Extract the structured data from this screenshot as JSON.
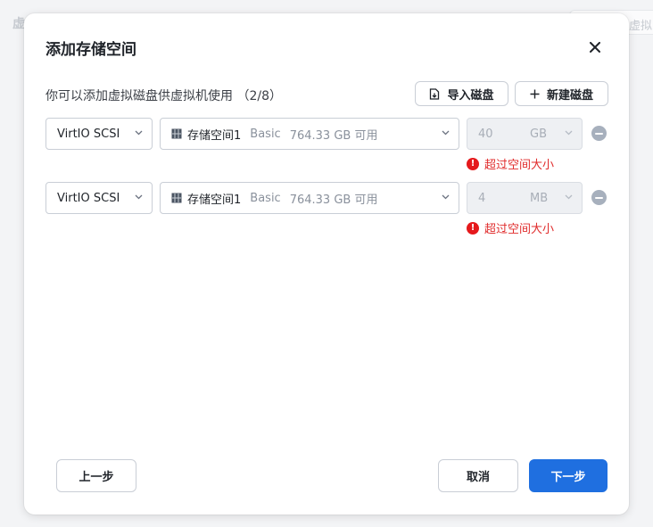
{
  "background": {
    "title": "虚",
    "chip_label": "虚拟"
  },
  "dialog": {
    "title": "添加存储空间",
    "close_icon": "close-icon",
    "subtitle": "你可以添加虚拟磁盘供虚拟机使用 （2/8）",
    "import_label": "导入磁盘",
    "new_label": "新建磁盘"
  },
  "disks": [
    {
      "controller": "VirtIO SCSI",
      "pool_name": "存储空间1",
      "pool_type": "Basic",
      "pool_free": "764.33 GB 可用",
      "size": "40",
      "unit": "GB",
      "error": "超过空间大小"
    },
    {
      "controller": "VirtIO SCSI",
      "pool_name": "存储空间1",
      "pool_type": "Basic",
      "pool_free": "764.33 GB 可用",
      "size": "4",
      "unit": "MB",
      "error": "超过空间大小"
    }
  ],
  "footer": {
    "prev_label": "上一步",
    "cancel_label": "取消",
    "next_label": "下一步"
  },
  "colors": {
    "primary": "#1f6fe0",
    "error": "#e02b2b",
    "disabled_bg": "#eef0f3"
  }
}
